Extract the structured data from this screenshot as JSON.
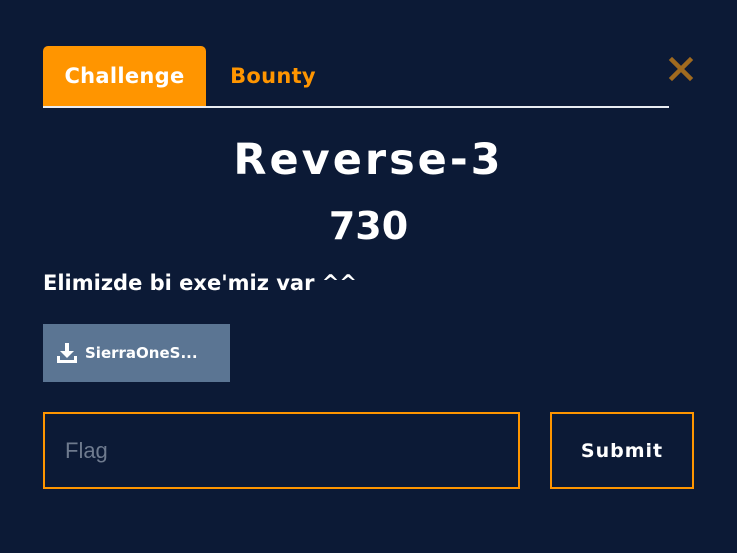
{
  "tabs": [
    {
      "label": "Challenge",
      "active": true
    },
    {
      "label": "Bounty",
      "active": false
    }
  ],
  "challenge": {
    "name": "Reverse-3",
    "value": "730",
    "description": "Elimizde bi exe'miz var ^^",
    "file": {
      "label": "SierraOneS..."
    }
  },
  "form": {
    "flag_placeholder": "Flag",
    "flag_value": "",
    "submit_label": "Submit"
  },
  "icons": {
    "close": "close-icon",
    "download": "download-icon"
  },
  "colors": {
    "background": "#0c1a36",
    "accent": "#ff9500",
    "file_button": "#5b7593",
    "close_icon": "#a06a1f"
  }
}
